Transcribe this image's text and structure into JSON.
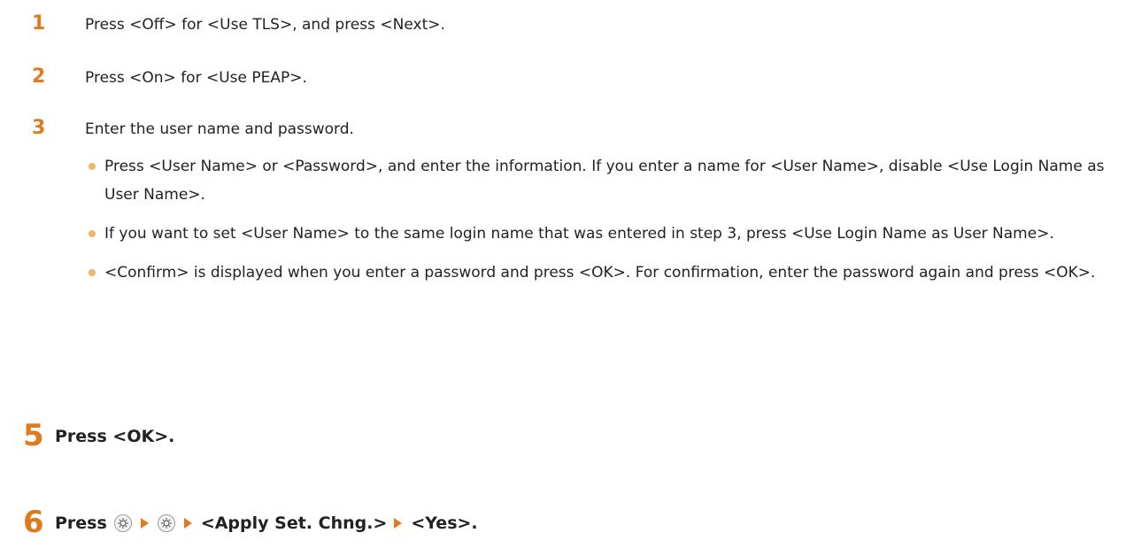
{
  "substeps": [
    {
      "num": "1",
      "text": "Press <Off> for <Use TLS>, and press <Next>."
    },
    {
      "num": "2",
      "text": "Press <On> for <Use PEAP>."
    },
    {
      "num": "3",
      "text": "Enter the user name and password."
    }
  ],
  "bullets": [
    "Press <User Name> or <Password>, and enter the information. If you enter a name for <User Name>, disable <Use Login Name as User Name>.",
    "If you want to set <User Name> to the same login name that was entered in step 3, press <Use Login Name as User Name>.",
    "<Confirm> is displayed when you enter a password and press <OK>. For confirmation, enter the password again and press <OK>."
  ],
  "steps": [
    {
      "num": "5",
      "text": "Press <OK>."
    },
    {
      "num": "6",
      "press": "Press",
      "item1": "<Apply Set. Chng.>",
      "item2": "<Yes>."
    }
  ],
  "icons": {
    "key": "settings-key-icon",
    "arrow": "arrow-right-icon"
  },
  "colors": {
    "accent": "#e07a1f",
    "bullet": "#f2b36a",
    "text": "#222222"
  }
}
